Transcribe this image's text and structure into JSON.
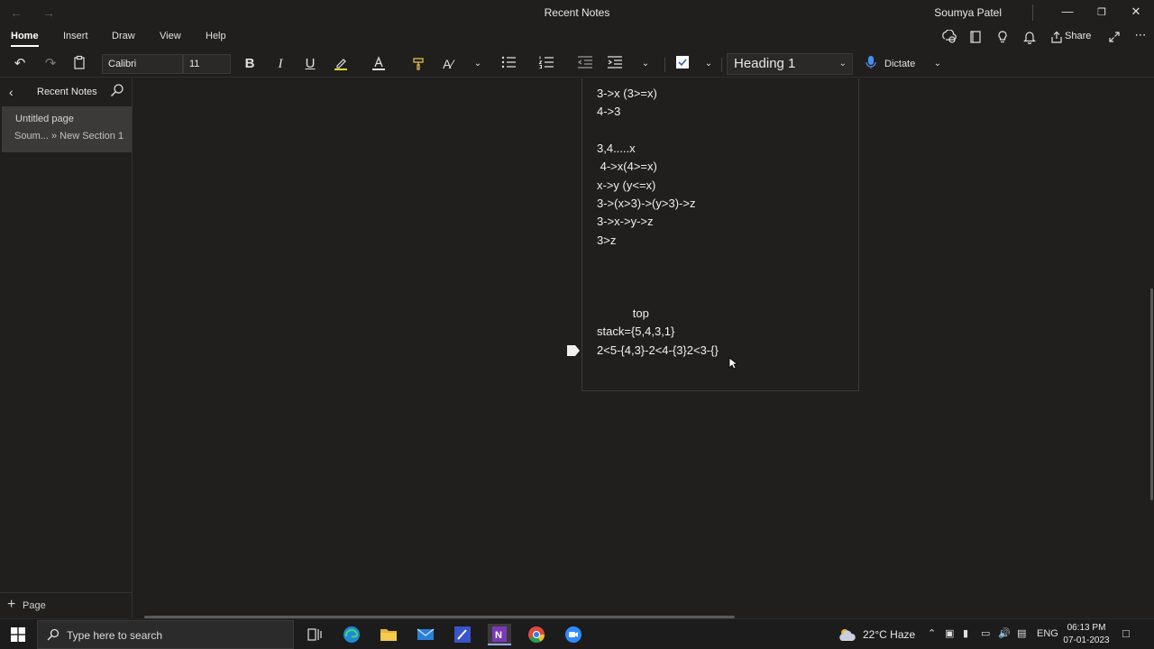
{
  "window": {
    "title": "Recent Notes",
    "user": "Soumya Patel"
  },
  "ribbon": {
    "tabs": [
      "Home",
      "Insert",
      "Draw",
      "View",
      "Help"
    ],
    "share_label": "Share"
  },
  "toolbar": {
    "font_name": "Calibri",
    "font_size": "11",
    "style": "Heading 1",
    "dictate_label": "Dictate"
  },
  "sidebar": {
    "title": "Recent Notes",
    "page_title": "Untitled page",
    "page_path": "Soum... » New Section 1",
    "add_page_label": "Page"
  },
  "note": {
    "lines": [
      "3->x (3>=x)",
      "4->3",
      "",
      "3,4.....x",
      " 4->x(4>=x)",
      "x->y (y<=x)",
      "3->(x>3)->(y>3)->z",
      "3->x->y->z",
      "3>z",
      "",
      "",
      "",
      "           top",
      "stack={5,4,3,1}",
      "2<5-{4,3}-2<4-{3}2<3-{}"
    ]
  },
  "taskbar": {
    "search_placeholder": "Type here to search",
    "weather": "22°C  Haze",
    "language": "ENG",
    "time": "06:13 PM",
    "date": "07-01-2023"
  },
  "colors": {
    "background": "#201f1e",
    "sidebar_selected": "#3b3a39",
    "taskbar": "#1c1c1c",
    "dictate_icon": "#4a8ef0",
    "onenote": "#7b39b8"
  }
}
